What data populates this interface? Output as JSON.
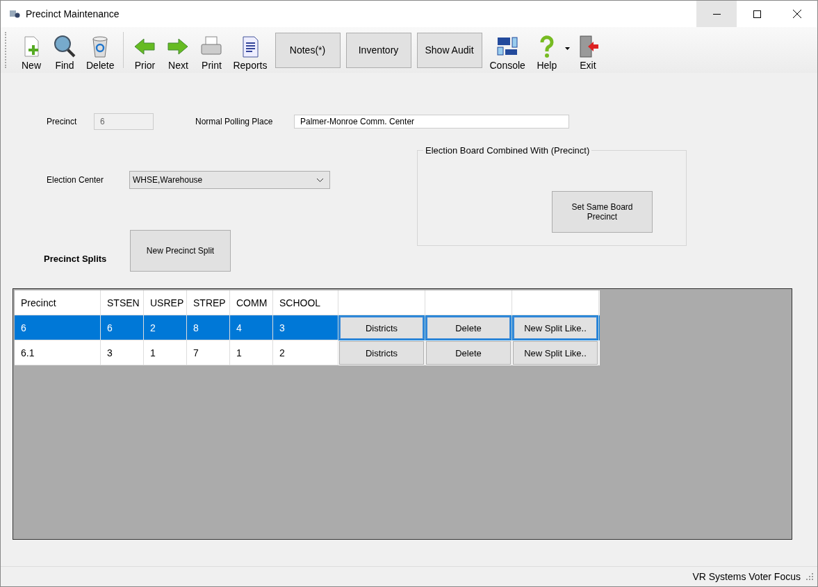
{
  "window": {
    "title": "Precinct Maintenance"
  },
  "toolbar": [
    {
      "kind": "icon",
      "label": "New"
    },
    {
      "kind": "icon",
      "label": "Find"
    },
    {
      "kind": "icon",
      "label": "Delete"
    },
    {
      "kind": "icon",
      "label": "Prior"
    },
    {
      "kind": "icon",
      "label": "Next"
    },
    {
      "kind": "icon",
      "label": "Print"
    },
    {
      "kind": "icon",
      "label": "Reports"
    },
    {
      "kind": "button",
      "label": "Notes(*)"
    },
    {
      "kind": "button",
      "label": "Inventory"
    },
    {
      "kind": "button",
      "label": "Show Audit"
    },
    {
      "kind": "icon",
      "label": "Console"
    },
    {
      "kind": "icon_menu",
      "label": "Help"
    },
    {
      "kind": "icon",
      "label": "Exit"
    }
  ],
  "form": {
    "precinct_label": "Precinct",
    "precinct_value": "6",
    "polling_label": "Normal Polling Place",
    "polling_value": "Palmer-Monroe Comm. Center",
    "center_label": "Election Center",
    "center_value": "WHSE,Warehouse",
    "board_group_title": "Election Board Combined With (Precinct)",
    "board_button": "Set Same Board Precinct",
    "splits_label": "Precinct Splits",
    "new_split_button": "New Precinct Split"
  },
  "table": {
    "columns": [
      "Precinct",
      "STSEN",
      "USREP",
      "STREP",
      "COMM",
      "SCHOOL"
    ],
    "rows": [
      {
        "selected": true,
        "cells": [
          "6",
          "6",
          "2",
          "8",
          "4",
          "3"
        ],
        "actions": [
          "Districts",
          "Delete",
          "New Split Like.."
        ]
      },
      {
        "selected": false,
        "cells": [
          "6.1",
          "3",
          "1",
          "7",
          "1",
          "2"
        ],
        "actions": [
          "Districts",
          "Delete",
          "New Split Like.."
        ]
      }
    ]
  },
  "status_bar": {
    "text": "VR Systems Voter Focus"
  }
}
